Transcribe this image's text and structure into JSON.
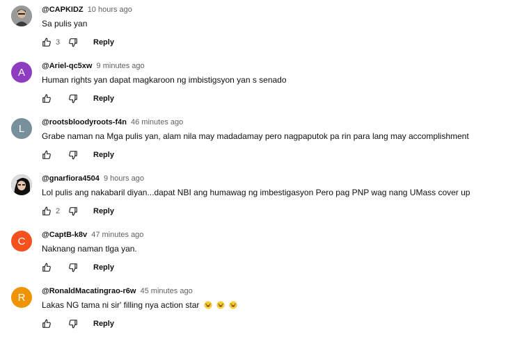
{
  "comments": [
    {
      "author": "@CAPKIDZ",
      "time": "10 hours ago",
      "text": "Sa pulis yan",
      "likes": "3",
      "reply_label": "Reply",
      "avatar": {
        "type": "photo",
        "letter": "",
        "color": "#8a8a8a"
      }
    },
    {
      "author": "@Ariel-qc5xw",
      "time": "9 minutes ago",
      "text": "Human rights yan dapat magkaroon ng imbistigsyon yan s senado",
      "likes": "",
      "reply_label": "Reply",
      "avatar": {
        "type": "letter",
        "letter": "A",
        "color": "#8e3dc1"
      }
    },
    {
      "author": "@rootsbloodyroots-f4n",
      "time": "46 minutes ago",
      "text": "Grabe naman na Mga pulis yan, alam nila may madadamay pero nagpaputok pa rin para lang may accomplishment",
      "likes": "",
      "reply_label": "Reply",
      "avatar": {
        "type": "letter",
        "letter": "L",
        "color": "#78909c"
      }
    },
    {
      "author": "@gnarfiora4504",
      "time": "9 hours ago",
      "text": "Lol pulis ang nakabaril diyan...dapat NBI ang  humawag ng imbestigasyon Pero pag PNP wag nang UMass cover up",
      "likes": "2",
      "reply_label": "Reply",
      "avatar": {
        "type": "photo",
        "letter": "",
        "color": "#4a4a4a"
      }
    },
    {
      "author": "@CaptB-k8v",
      "time": "47 minutes ago",
      "text": "Naknang naman tlga yan.",
      "likes": "",
      "reply_label": "Reply",
      "avatar": {
        "type": "letter",
        "letter": "C",
        "color": "#f4511e"
      }
    },
    {
      "author": "@RonaldMacatingrao-r6w",
      "time": "45 minutes ago",
      "text": "Lakas NG tama ni sir' filling nya action star",
      "emojis": [
        "laughing-tears-emoji",
        "laughing-tears-emoji",
        "laughing-tears-emoji"
      ],
      "likes": "",
      "reply_label": "Reply",
      "avatar": {
        "type": "letter",
        "letter": "R",
        "color": "#f09300"
      }
    }
  ],
  "icons": {
    "like": "thumb-up-outline-icon",
    "dislike": "thumb-down-outline-icon"
  }
}
